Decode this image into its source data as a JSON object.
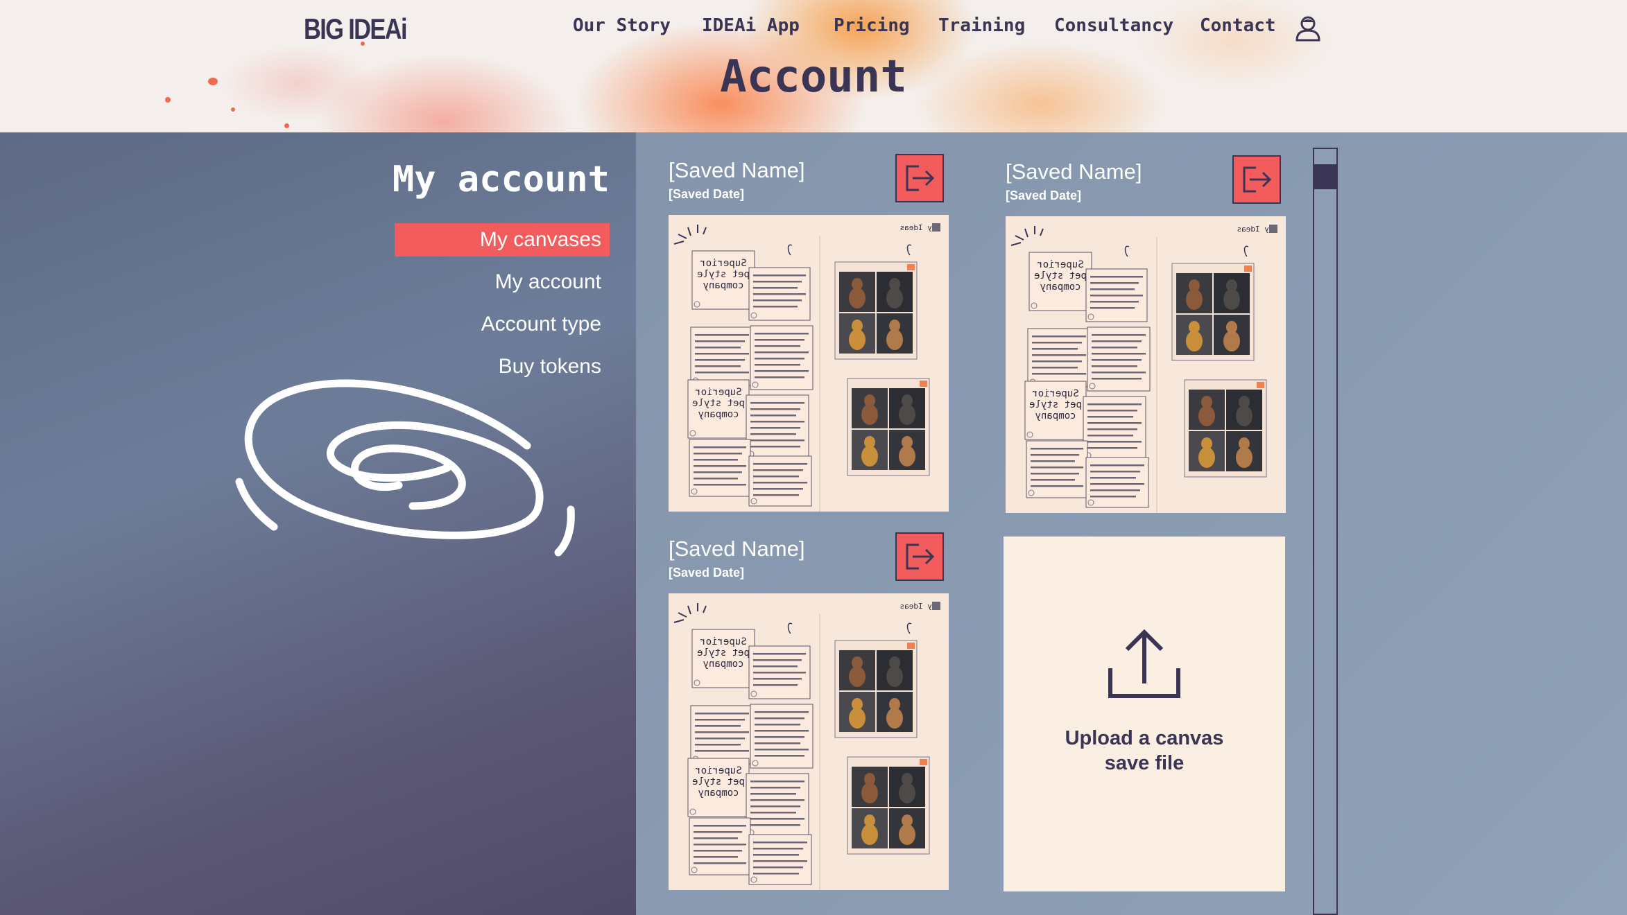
{
  "brand": {
    "logo_text": "BIG IDEAi"
  },
  "nav": {
    "items": [
      {
        "label": "Our Story"
      },
      {
        "label": "IDEAi App"
      },
      {
        "label": "Pricing"
      },
      {
        "label": "Training"
      },
      {
        "label": "Consultancy"
      },
      {
        "label": "Contact"
      }
    ],
    "user_icon": "user-icon"
  },
  "page": {
    "title": "Account"
  },
  "sidebar": {
    "title": "My account",
    "items": [
      {
        "label": "My canvases",
        "active": true
      },
      {
        "label": "My account",
        "active": false
      },
      {
        "label": "Account type",
        "active": false
      },
      {
        "label": "Buy tokens",
        "active": false
      }
    ],
    "decoration_icon": "swirl-icon"
  },
  "canvases": [
    {
      "name": "[Saved Name]",
      "date": "[Saved Date]",
      "open_icon": "open-canvas-icon"
    },
    {
      "name": "[Saved Name]",
      "date": "[Saved Date]",
      "open_icon": "open-canvas-icon"
    },
    {
      "name": "[Saved Name]",
      "date": "[Saved Date]",
      "open_icon": "open-canvas-icon"
    }
  ],
  "thumbnail": {
    "header_label": "My Ideas",
    "note_title": "Superior pet style company"
  },
  "upload": {
    "label_line1": "Upload a canvas",
    "label_line2": "save file",
    "icon": "upload-icon"
  },
  "colors": {
    "accent": "#f25c5c",
    "dark": "#3a3555",
    "card_bg": "#fbeee3",
    "left_pane": "#5e6a86",
    "right_pane": "#8a9bb2"
  }
}
